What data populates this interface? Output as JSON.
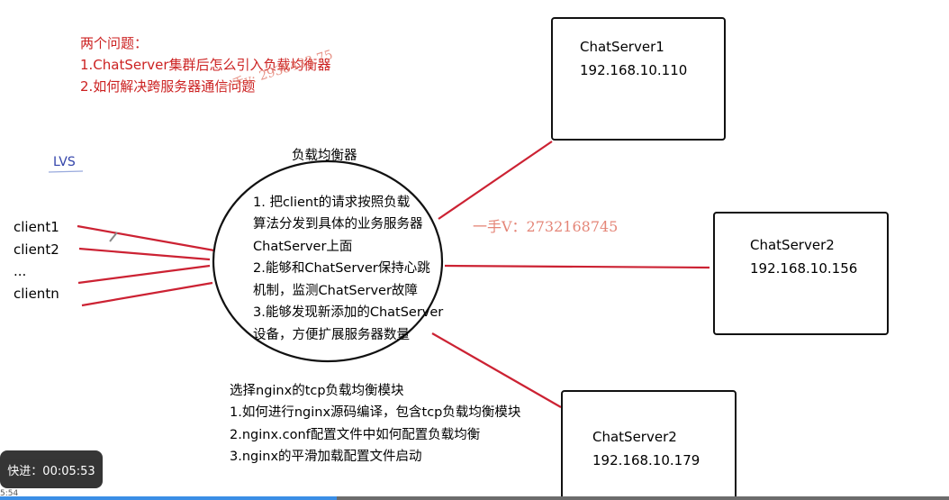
{
  "notes": {
    "heading": "两个问题：",
    "q1": "1.ChatServer集群后怎么引入负载均衡器",
    "q2": "2.如何解决跨服务器通信问题"
  },
  "lvs_label": "LVS",
  "clients": [
    "client1",
    "client2",
    "...",
    "clientn"
  ],
  "balancer": {
    "title": "负载均衡器",
    "lines": [
      "1. 把client的请求按照负载",
      "算法分发到具体的业务服务器",
      "ChatServer上面",
      "2.能够和ChatServer保持心跳",
      "机制，监测ChatServer故障",
      "3.能够发现新添加的ChatServer",
      "设备，方便扩展服务器数量"
    ]
  },
  "servers": [
    {
      "name": "ChatServer1",
      "ip": "192.168.10.110"
    },
    {
      "name": "ChatServer2",
      "ip": "192.168.10.156"
    },
    {
      "name": "ChatServer2",
      "ip": "192.168.10.179"
    }
  ],
  "nginx_notes": [
    "选择nginx的tcp负载均衡模块",
    "1.如何进行nginx源码编译，包含tcp负载均衡模块",
    "2.nginx.conf配置文件中如何配置负载均衡",
    "3.nginx的平滑加载配置文件启动"
  ],
  "watermarks": [
    "一手v: 2938433 75",
    "一手V：2732168745"
  ],
  "player": {
    "overlay_text": "快进：00:05:53",
    "time_left": "5:54",
    "progress_fraction": 0.355
  },
  "colors": {
    "accent_red": "#cc2222",
    "line_red": "#cc2233",
    "lvs_blue": "#3344aa",
    "progress_blue": "#3a8ee6"
  }
}
